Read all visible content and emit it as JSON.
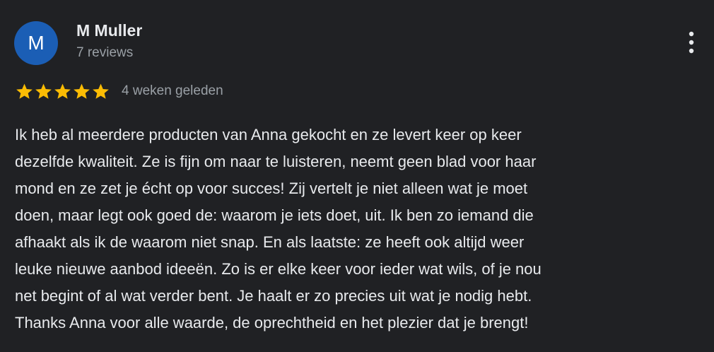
{
  "reviewer": {
    "initial": "M",
    "name": "M Muller",
    "review_count": "7 reviews",
    "avatar_color": "#1b5eb5"
  },
  "actions": {
    "more_icon": "more-vertical-icon"
  },
  "rating": {
    "stars": 5,
    "max_stars": 5,
    "star_color": "#fbbc04",
    "date": "4 weken geleden"
  },
  "review": {
    "lines": [
      "Ik heb al meerdere producten van Anna gekocht en ze levert keer op keer",
      "dezelfde kwaliteit. Ze is fijn om naar te luisteren, neemt geen blad voor haar",
      "mond en ze zet je écht op voor succes! Zij vertelt je niet alleen wat je moet",
      "doen, maar legt ook goed de: waarom je iets doet, uit. Ik ben zo iemand die",
      "afhaakt als ik de waarom niet snap. En als laatste: ze heeft ook altijd weer",
      "leuke nieuwe aanbod ideeën. Zo is er elke keer voor ieder wat wils, of je nou",
      "net begint of al wat verder bent. Je haalt er zo precies uit wat je nodig hebt.",
      "Thanks Anna voor alle waarde, de oprechtheid en het plezier dat je brengt!"
    ]
  }
}
